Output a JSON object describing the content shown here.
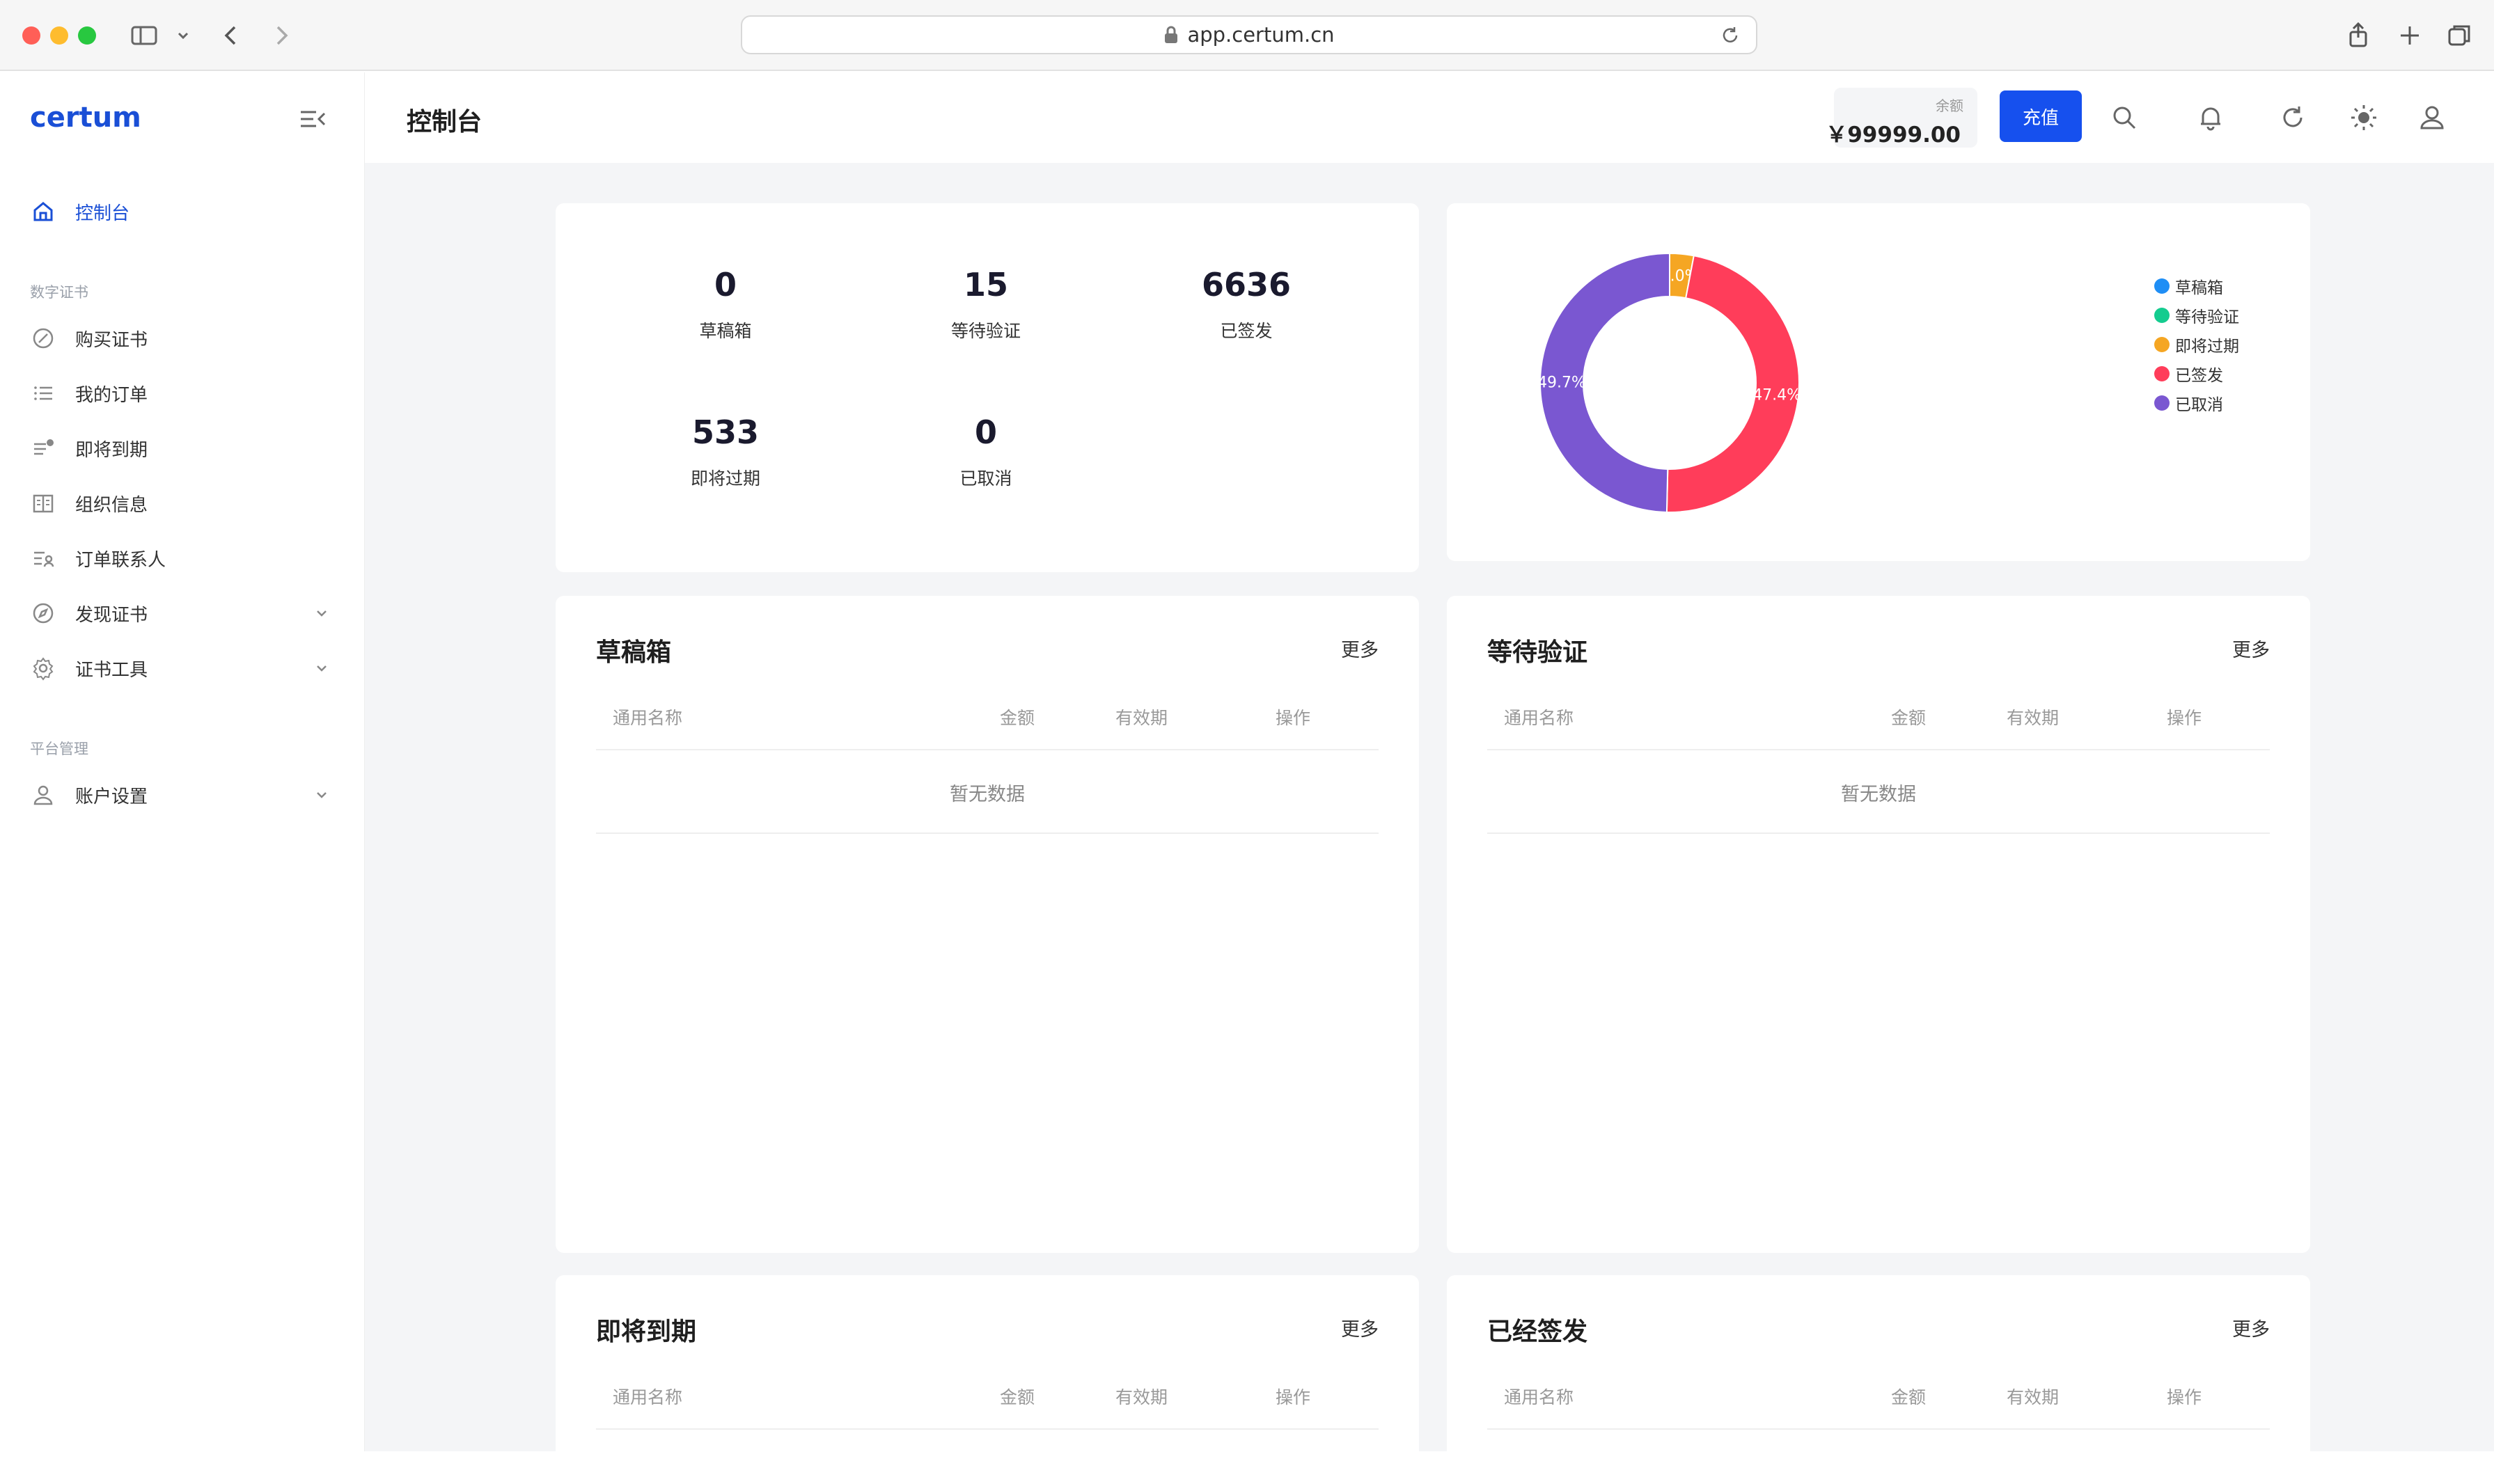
{
  "browser": {
    "url": "app.certum.cn"
  },
  "sidebar": {
    "logo": "certum",
    "home": "控制台",
    "section_cert": "数字证书",
    "items": [
      "购买证书",
      "我的订单",
      "即将到期",
      "组织信息",
      "订单联系人",
      "发现证书",
      "证书工具"
    ],
    "section_platform": "平台管理",
    "account": "账户设置"
  },
  "header": {
    "title": "控制台",
    "balance_label": "余额",
    "balance_value": "￥99999.00",
    "recharge": "充值"
  },
  "stats": [
    {
      "value": "0",
      "label": "草稿箱"
    },
    {
      "value": "15",
      "label": "等待验证"
    },
    {
      "value": "6636",
      "label": "已签发"
    },
    {
      "value": "533",
      "label": "即将过期"
    },
    {
      "value": "0",
      "label": "已取消"
    }
  ],
  "chart_data": {
    "type": "pie",
    "categories": [
      "草稿箱",
      "等待验证",
      "即将过期",
      "已签发",
      "已取消"
    ],
    "values": [
      0,
      0,
      3.0,
      47.4,
      49.7
    ],
    "data_labels": [
      "",
      "",
      "3.0%",
      "47.4%",
      "49.7%"
    ],
    "colors": [
      "#1f8ef5",
      "#14cc8f",
      "#f5a623",
      "#ff3d5a",
      "#7a57d1"
    ],
    "legend_position": "top-right"
  },
  "tables": [
    {
      "title": "草稿箱",
      "more": "更多",
      "columns": [
        "通用名称",
        "金额",
        "有效期",
        "操作"
      ],
      "empty": "暂无数据"
    },
    {
      "title": "等待验证",
      "more": "更多",
      "columns": [
        "通用名称",
        "金额",
        "有效期",
        "操作"
      ],
      "empty": "暂无数据"
    },
    {
      "title": "即将到期",
      "more": "更多",
      "columns": [
        "通用名称",
        "金额",
        "有效期",
        "操作"
      ]
    },
    {
      "title": "已经签发",
      "more": "更多",
      "columns": [
        "通用名称",
        "金额",
        "有效期",
        "操作"
      ]
    }
  ]
}
